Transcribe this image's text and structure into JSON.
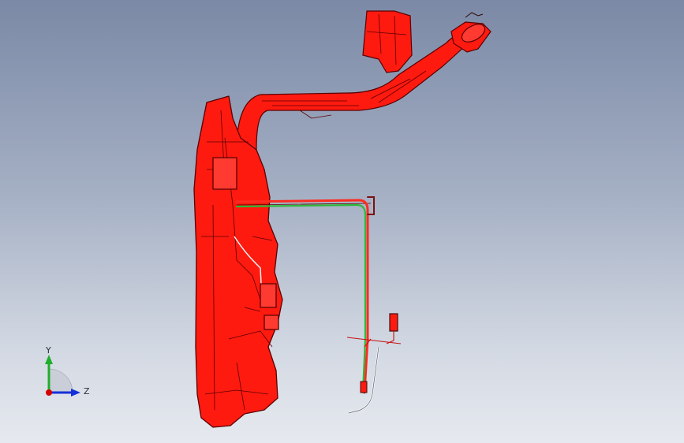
{
  "colors": {
    "background_top": "#7b89a6",
    "background_bottom": "#e6e9ef",
    "part_fill": "#ff1a10",
    "part_edge": "#5a0000",
    "hose_green": "#2db83a",
    "line_white": "#f2f2f2",
    "sensor_dark": "#3a1010",
    "axis_x": "#d40000",
    "axis_y": "#1fae2a",
    "axis_z": "#1530d8"
  },
  "icons": {
    "triad": "coordinate-triad-icon",
    "x_axis": "x-axis-arrow-icon",
    "y_axis": "y-axis-arrow-icon",
    "z_axis": "z-axis-arrow-icon"
  },
  "triad": {
    "y_label": "Y",
    "z_label": "Z"
  }
}
